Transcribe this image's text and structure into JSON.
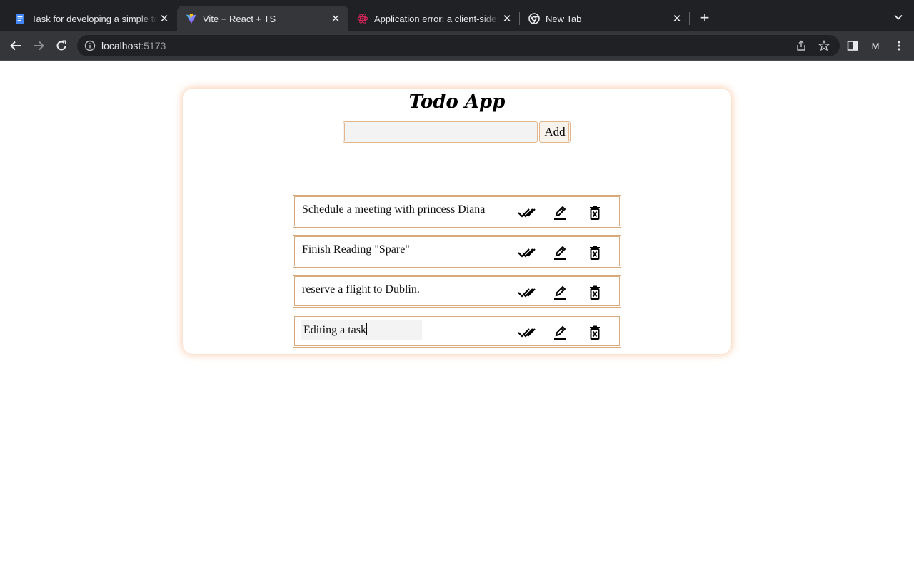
{
  "browser": {
    "tabs": [
      {
        "title": "Task for developing a simple to",
        "favicon": "google-docs-icon",
        "active": false
      },
      {
        "title": "Vite + React + TS",
        "favicon": "vite-icon",
        "active": true
      },
      {
        "title": "Application error: a client-side",
        "favicon": "react-icon",
        "active": false
      },
      {
        "title": "New Tab",
        "favicon": "chrome-icon",
        "active": false
      }
    ],
    "address": {
      "host": "localhost",
      "port": ":5173"
    },
    "profile_initial": "M"
  },
  "app": {
    "title": "Todo App",
    "new_task": {
      "value": "",
      "placeholder": ""
    },
    "add_label": "Add",
    "todos": [
      {
        "text": "Schedule a meeting with princess Diana",
        "editing": false
      },
      {
        "text": "Finish Reading \"Spare\"",
        "editing": false
      },
      {
        "text": "reserve a flight to Dublin.",
        "editing": false
      },
      {
        "text": "Editing a task",
        "editing": true
      }
    ]
  },
  "colors": {
    "chrome_dark": "#202124",
    "chrome_toolbar": "#35363a",
    "accent_border": "#d9a97e",
    "card_glow": "#f7c4a0"
  }
}
